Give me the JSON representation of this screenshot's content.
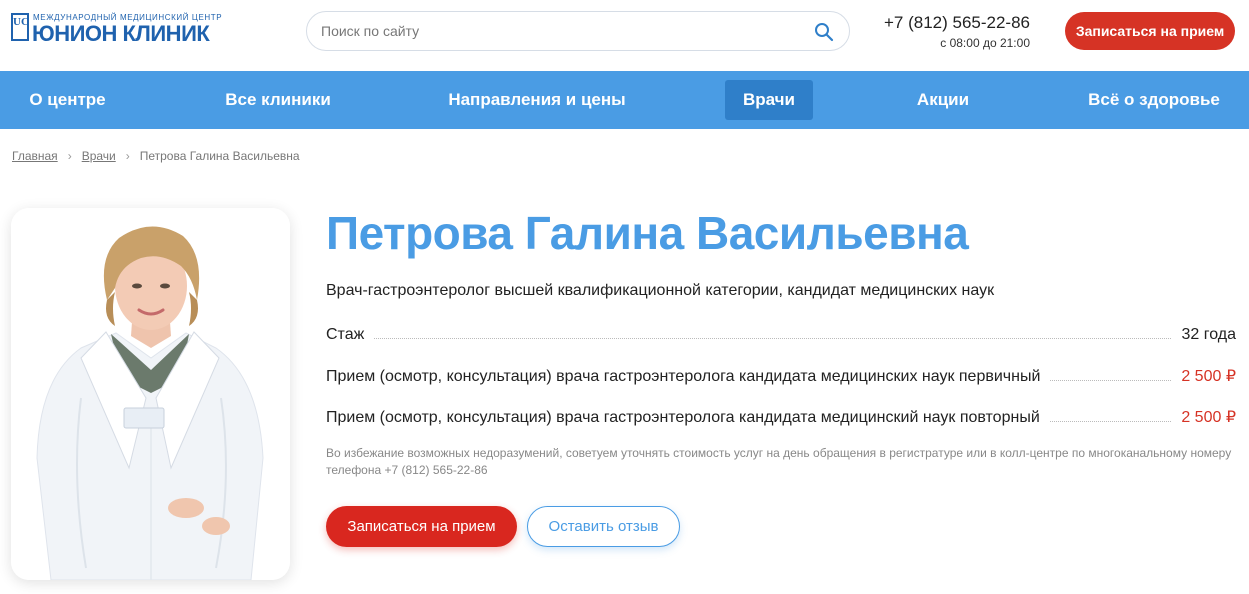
{
  "logo": {
    "small_text": "МЕЖДУНАРОДНЫЙ МЕДИЦИНСКИЙ ЦЕНТР",
    "big_text": "ЮНИОН КЛИНИК",
    "mark": "UC"
  },
  "search": {
    "placeholder": "Поиск по сайту",
    "icon": "search-icon"
  },
  "contact": {
    "phone": "+7 (812) 565-22-86",
    "hours": "с 08:00 до 21:00"
  },
  "header_button": "Записаться на прием",
  "nav": [
    {
      "label": "О центре",
      "active": false
    },
    {
      "label": "Все клиники",
      "active": false
    },
    {
      "label": "Направления и цены",
      "active": false
    },
    {
      "label": "Врачи",
      "active": true
    },
    {
      "label": "Акции",
      "active": false
    },
    {
      "label": "Всё о здоровье",
      "active": false
    }
  ],
  "breadcrumb": {
    "items": [
      "Главная",
      "Врачи",
      "Петрова Галина Васильевна"
    ],
    "separator": "›"
  },
  "doctor": {
    "name": "Петрова Галина Васильевна",
    "title": "Врач-гастроэнтеролог высшей квалификационной категории, кандидат медицинских наук",
    "experience_label": "Стаж",
    "experience_value": "32 года",
    "services": [
      {
        "name": "Прием (осмотр, консультация) врача гастроэнтеролога кандидата медицинских наук первичный",
        "price": "2 500 ₽"
      },
      {
        "name": "Прием (осмотр, консультация) врача гастроэнтеролога кандидата медицинский наук повторный",
        "price": "2 500 ₽"
      }
    ],
    "note": "Во избежание возможных недоразумений, советуем уточнять стоимость услуг на день обращения в регистратуре или в колл-центре по многоканальному номеру телефона +7 (812) 565-22-86"
  },
  "actions": {
    "book": "Записаться на прием",
    "review": "Оставить отзыв"
  },
  "colors": {
    "brand_blue": "#4a9ce4",
    "nav_active": "#2f7fc9",
    "accent_red": "#d63325",
    "logo_blue": "#1f62ae"
  }
}
